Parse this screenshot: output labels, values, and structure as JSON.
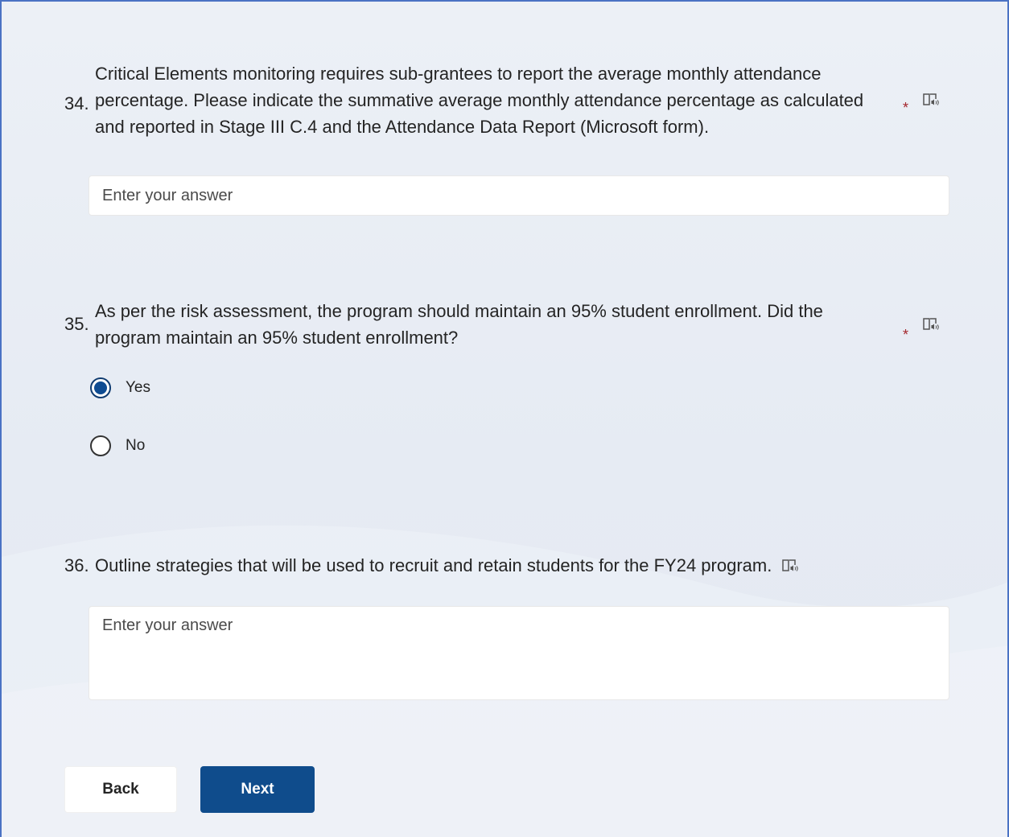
{
  "questions": [
    {
      "number": "34.",
      "text": "Critical Elements monitoring requires sub-grantees to report the average monthly attendance percentage. Please indicate the summative average monthly attendance percentage as calculated and reported in Stage III C.4 and the Attendance Data Report (Microsoft form).",
      "required_mark": "*",
      "icon": "immersive-reader-icon",
      "placeholder": "Enter your answer"
    },
    {
      "number": "35.",
      "text": "As per the risk assessment, the program should maintain an 95% student enrollment. Did the program maintain an 95% student enrollment?",
      "required_mark": "*",
      "icon": "immersive-reader-icon",
      "options": [
        "Yes",
        "No"
      ],
      "selected": "Yes"
    },
    {
      "number": "36.",
      "text": "Outline strategies that will be used to recruit and retain students for the FY24 program.",
      "icon": "immersive-reader-icon",
      "placeholder": "Enter your answer"
    }
  ],
  "buttons": {
    "back": "Back",
    "next": "Next"
  },
  "colors": {
    "accent": "#0f4c8c",
    "required": "#a4262c",
    "background": "#e8edf4"
  }
}
